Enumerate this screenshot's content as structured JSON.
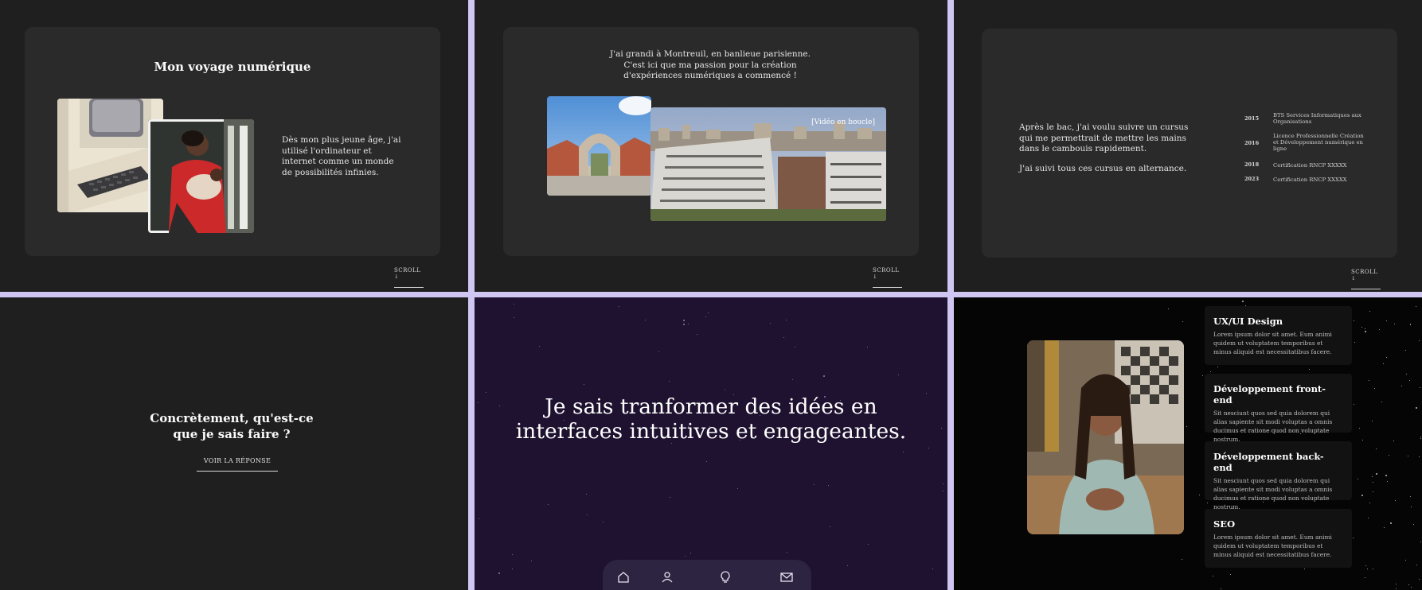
{
  "voyage": {
    "title": "Mon voyage numérique",
    "text": "Dès mon plus jeune âge, j'ai utilisé l'ordinateur et internet comme un monde de possibilités infinies.",
    "scroll": "SCROLL ↓"
  },
  "montreuil": {
    "text": "J'ai grandi à Montreuil, en banlieue parisienne. C'est ici que ma passion pour la création d'expériences numériques a commencé !",
    "video_label": "[Vidéo en boucle]",
    "scroll": "SCROLL ↓"
  },
  "parcours": {
    "text1": "Après le bac, j'ai voulu suivre un cursus qui me permettrait de mettre les mains dans le cambouis rapidement.",
    "text2": "J'ai suivi tous ces cursus en alternance.",
    "timeline": [
      {
        "year": "2015",
        "label": "BTS Services Informatiques aux Organisations"
      },
      {
        "year": "2016",
        "label": "Licence Professionnelle Création et Développement numérique en ligne"
      },
      {
        "year": "2018",
        "label": "Certification RNCP XXXXX"
      },
      {
        "year": "2023",
        "label": "Certification RNCP XXXXX"
      }
    ],
    "scroll": "SCROLL ↓"
  },
  "question": {
    "title": "Concrètement, qu'est-ce que je sais faire ?",
    "button": "VOIR LA RÉPONSE"
  },
  "tagline": {
    "text": "Je sais tranformer des idées en interfaces intuitives et engageantes.",
    "nav": [
      "home-icon",
      "user-icon",
      "lightbulb-icon",
      "mail-icon"
    ]
  },
  "services": [
    {
      "title": "UX/UI Design",
      "desc": "Lorem ipsum dolor sit amet. Eum animi quidem ut voluptatem temporibus et minus aliquid est necessitatibus facere."
    },
    {
      "title": "Développement front-end",
      "desc": "Sit nesciunt quos sed quia dolorem qui alias sapiente sit modi voluptas a omnis ducimus et ratione quod non voluptate nostrum."
    },
    {
      "title": "Développement back-end",
      "desc": "Sit nesciunt quos sed quia dolorem qui alias sapiente sit modi voluptas a omnis ducimus et ratione quod non voluptate nostrum."
    },
    {
      "title": "SEO",
      "desc": "Lorem ipsum dolor sit amet. Eum animi quidem ut voluptatem temporibus et minus aliquid est necessitatibus facere."
    }
  ],
  "colors": {
    "accent": "#cfc6f2",
    "panel": "#1f1f1f",
    "card": "#2a2a2a",
    "purple": "#1e1230"
  }
}
